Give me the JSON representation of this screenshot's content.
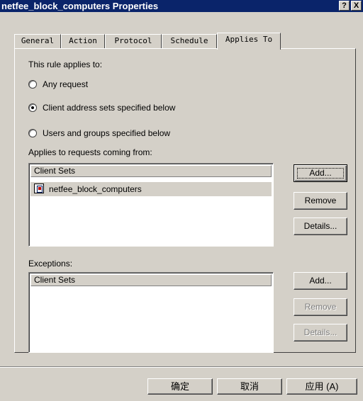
{
  "window": {
    "title": "netfee_block_computers Properties",
    "help_button": "?",
    "close_button": "X"
  },
  "tabs": [
    {
      "label": "General",
      "active": false
    },
    {
      "label": "Action",
      "active": false
    },
    {
      "label": "Protocol",
      "active": false
    },
    {
      "label": "Schedule",
      "active": false
    },
    {
      "label": "Applies To",
      "active": true
    }
  ],
  "applies_to": {
    "heading": "This rule applies to:",
    "options": [
      {
        "label": "Any request",
        "checked": false
      },
      {
        "label": "Client address sets specified below",
        "checked": true
      },
      {
        "label": "Users and groups specified below",
        "checked": false
      }
    ],
    "requests_label": "Applies to requests coming from:",
    "requests_list": {
      "column": "Client Sets",
      "items": [
        "netfee_block_computers"
      ]
    },
    "requests_buttons": {
      "add": "Add...",
      "remove": "Remove",
      "details": "Details..."
    },
    "exceptions_label": "Exceptions:",
    "exceptions_list": {
      "column": "Client Sets",
      "items": []
    },
    "exceptions_buttons": {
      "add": "Add...",
      "remove": "Remove",
      "details": "Details..."
    }
  },
  "footer": {
    "ok": "确定",
    "cancel": "取消",
    "apply": "应用 (A)"
  }
}
